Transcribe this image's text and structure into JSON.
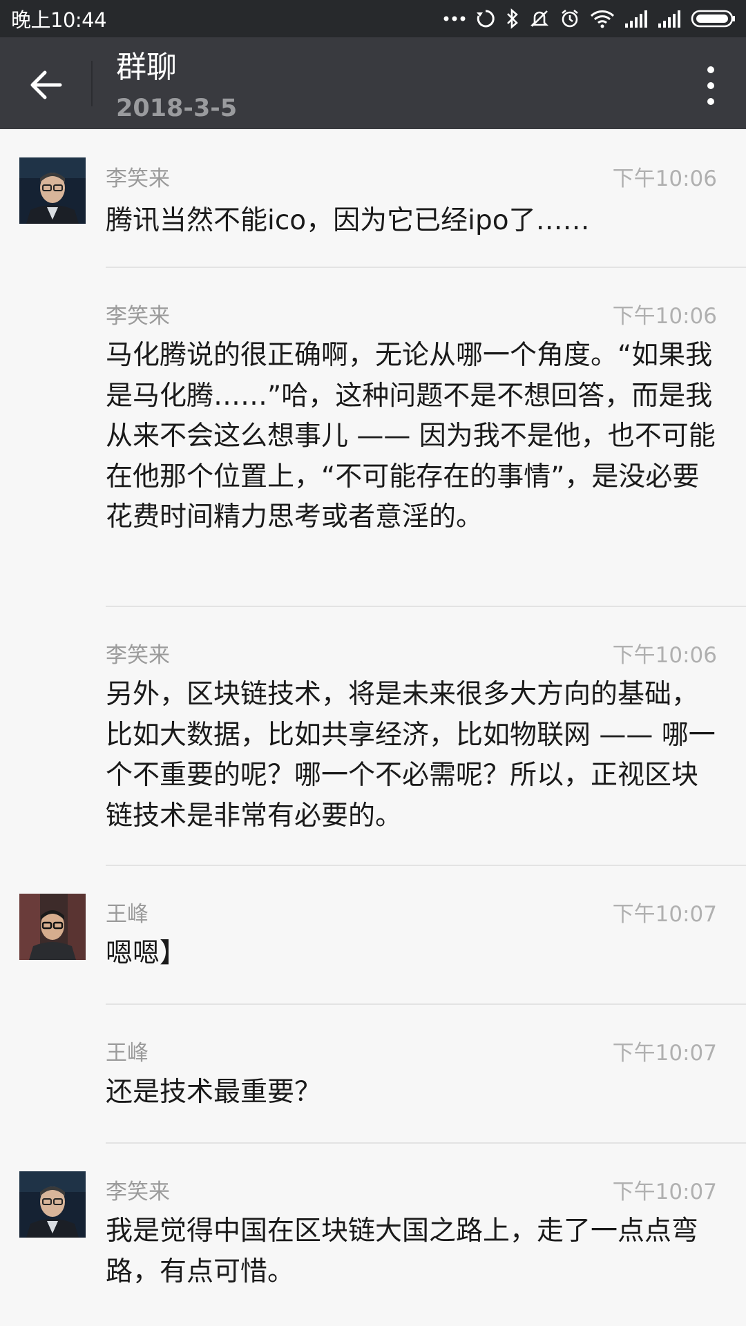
{
  "status_bar": {
    "time": "晚上10:44",
    "icons": [
      "more-dots-icon",
      "sync-icon",
      "bluetooth-icon",
      "mute-icon",
      "alarm-icon",
      "wifi-icon",
      "signal-icon",
      "signal-icon",
      "battery-icon"
    ]
  },
  "header": {
    "title": "群聊",
    "subtitle": "2018-3-5"
  },
  "messages": [
    {
      "sender": "李笑来",
      "time": "下午10:06",
      "content": "腾讯当然不能ico，因为它已经ipo了……",
      "avatar": "li-xiaolai"
    },
    {
      "sender": "李笑来",
      "time": "下午10:06",
      "content": "马化腾说的很正确啊，无论从哪一个角度。“如果我是马化腾……”哈，这种问题不是不想回答，而是我从来不会这么想事儿 —— 因为我不是他，也不可能在他那个位置上，“不可能存在的事情”，是没必要花费时间精力思考或者意淫的。",
      "avatar": ""
    },
    {
      "sender": "李笑来",
      "time": "下午10:06",
      "content": "另外，区块链技术，将是未来很多大方向的基础，比如大数据，比如共享经济，比如物联网 —— 哪一个不重要的呢？哪一个不必需呢？所以，正视区块链技术是非常有必要的。",
      "avatar": ""
    },
    {
      "sender": "王峰",
      "time": "下午10:07",
      "content": "嗯嗯】",
      "avatar": "wang-feng"
    },
    {
      "sender": "王峰",
      "time": "下午10:07",
      "content": "还是技术最重要？",
      "avatar": ""
    },
    {
      "sender": "李笑来",
      "time": "下午10:07",
      "content": "我是觉得中国在区块链大国之路上，走了一点点弯路，有点可惜。",
      "avatar": "li-xiaolai"
    }
  ]
}
